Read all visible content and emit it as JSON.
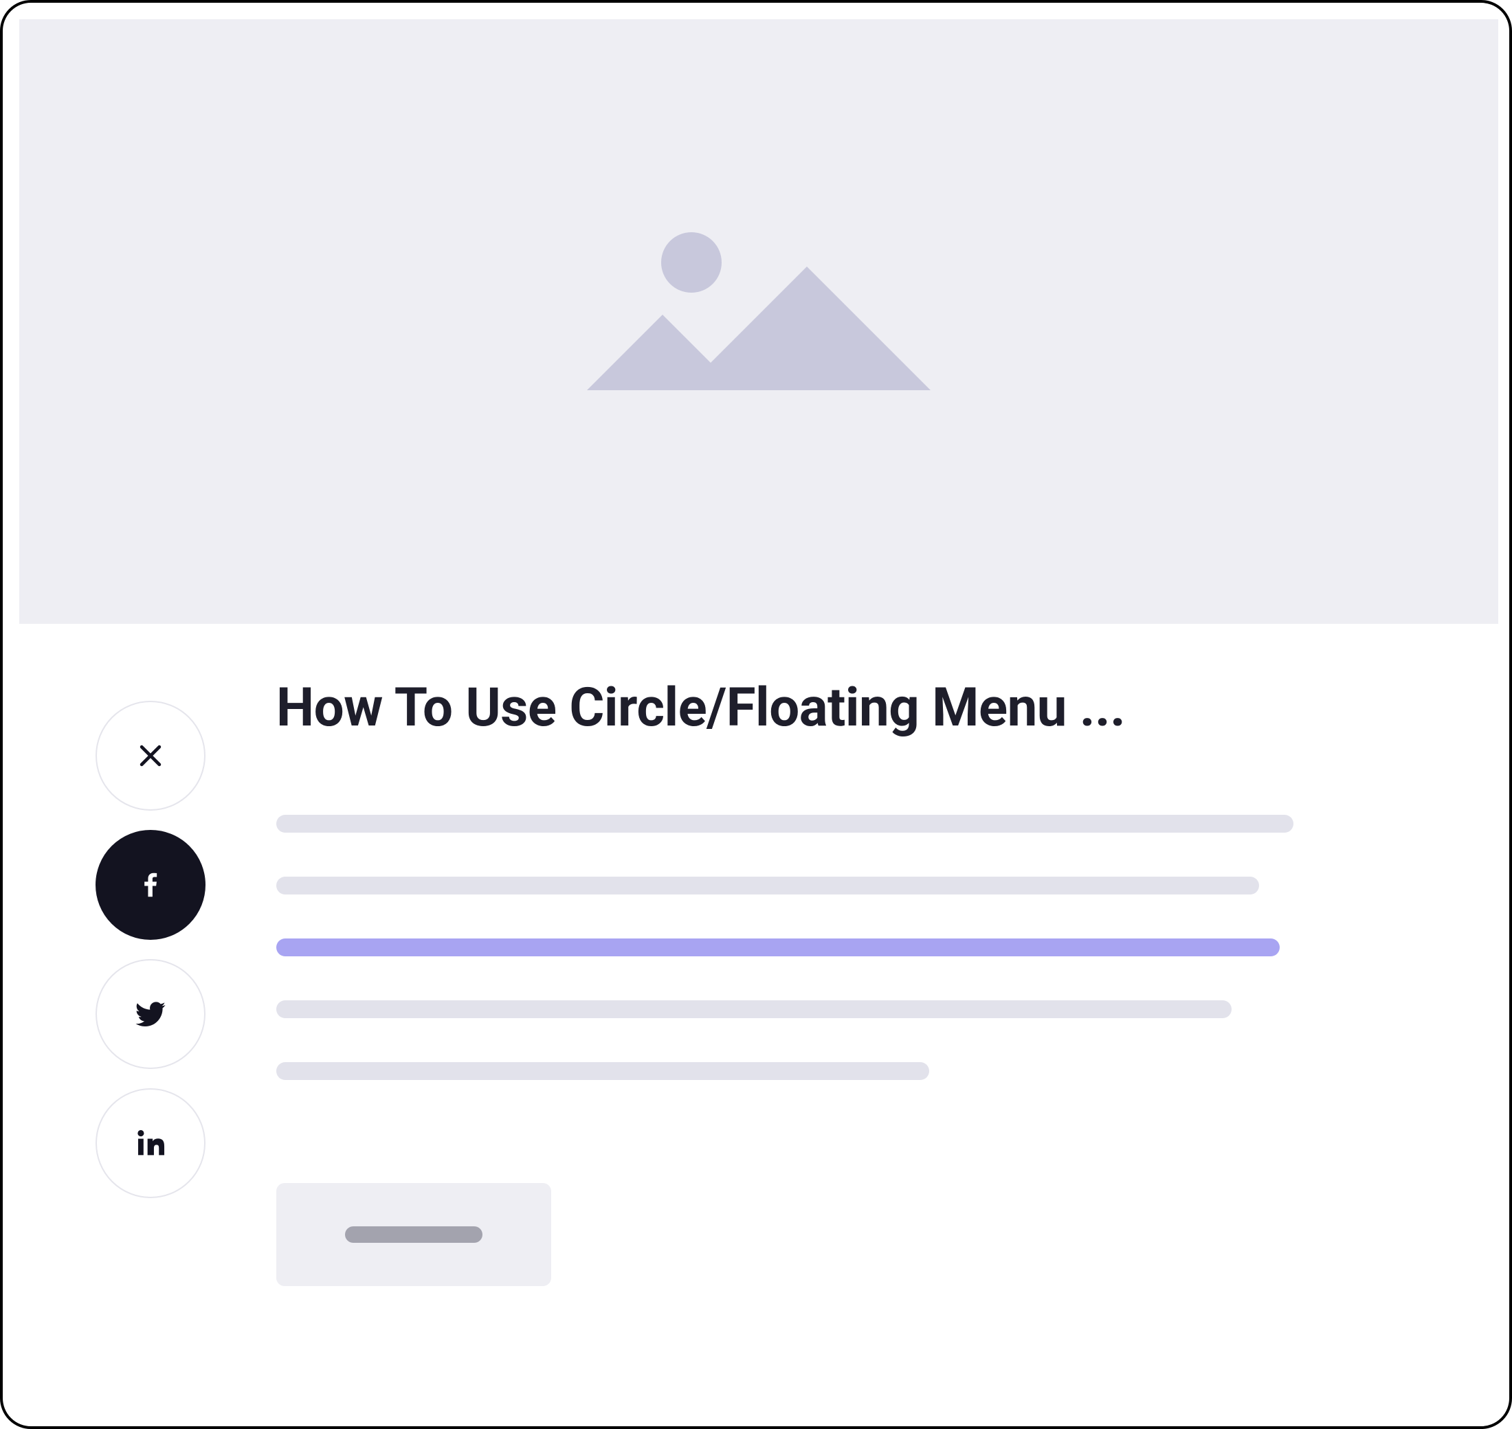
{
  "article": {
    "title": "How To Use Circle/Floating Menu ..."
  },
  "share_menu": {
    "items": [
      {
        "name": "close",
        "icon": "close-icon",
        "active": false
      },
      {
        "name": "facebook",
        "icon": "facebook-icon",
        "active": true
      },
      {
        "name": "twitter",
        "icon": "twitter-icon",
        "active": false
      },
      {
        "name": "linkedin",
        "icon": "linkedin-icon",
        "active": false
      }
    ]
  },
  "colors": {
    "placeholder_bg": "#EEEEF3",
    "placeholder_glyph": "#C8C8DC",
    "skeleton": "#E2E2EB",
    "skeleton_highlight": "#A8A4F2",
    "button_dark": "#131320",
    "text": "#1E1E2B"
  }
}
